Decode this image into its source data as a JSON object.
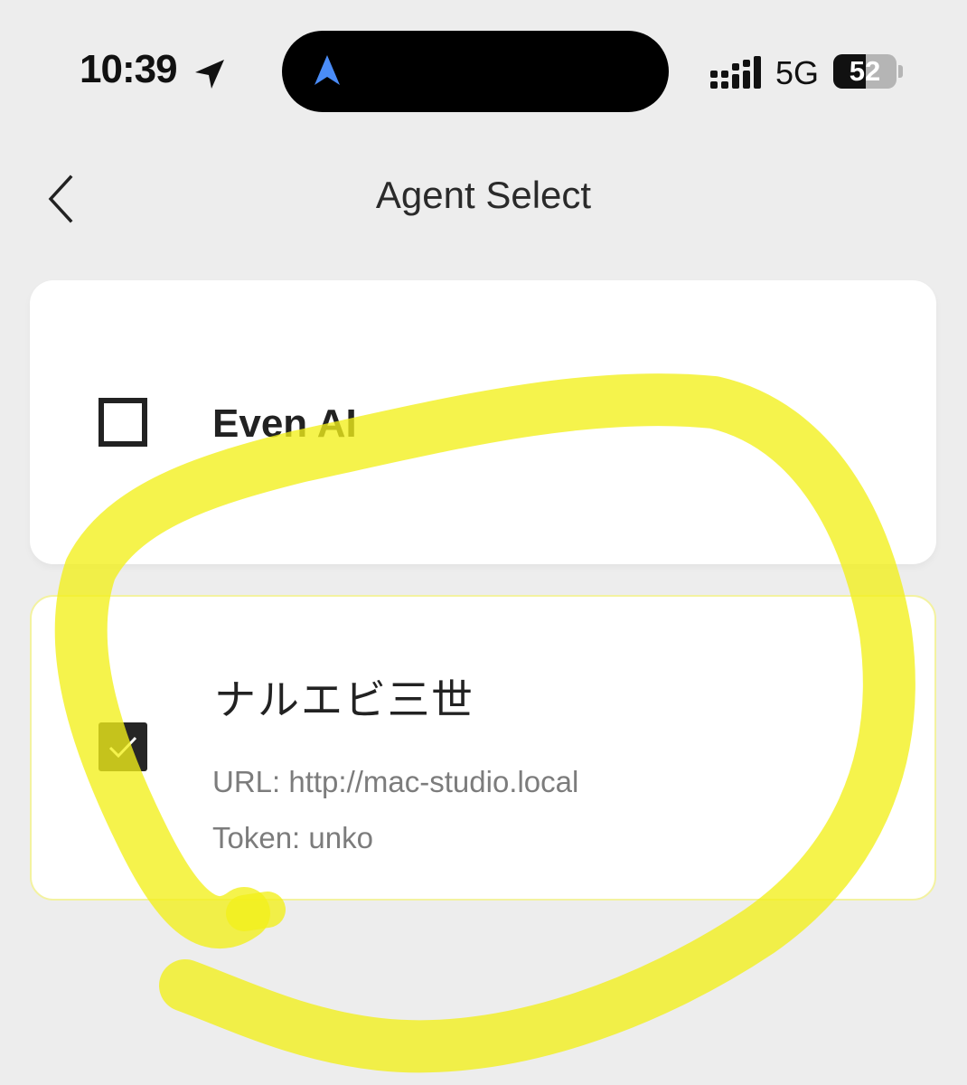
{
  "status_bar": {
    "time": "10:39",
    "network": "5G",
    "battery_level": "52",
    "battery_fraction": 0.52,
    "icons": [
      "location-arrow-icon",
      "navigation-icon",
      "signal-icon",
      "battery-icon"
    ]
  },
  "header": {
    "back_icon": "chevron-left-icon",
    "title": "Agent Select"
  },
  "agents": [
    {
      "name": "Even AI",
      "checked": false
    },
    {
      "name": "ナルエビ三世",
      "checked": true,
      "url": "URL: http://mac-studio.local",
      "token": "Token: unko"
    }
  ],
  "colors": {
    "background": "#ededed",
    "card": "#ffffff",
    "highlighter": "#f2f01a",
    "island_nav_icon": "#4a8cf7",
    "detail_text": "#7c7c7c"
  }
}
